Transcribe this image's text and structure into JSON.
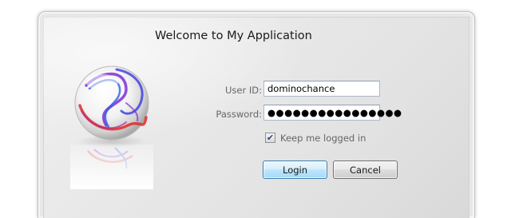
{
  "dialog": {
    "title": "Welcome to My Application"
  },
  "logo": {
    "icon": "swirl-orb-logo",
    "colors": [
      "#7b2fd6",
      "#2f5ee0",
      "#e02a2a"
    ]
  },
  "form": {
    "user_id_label": "User ID:",
    "user_id_value": "dominochance",
    "password_label": "Password:",
    "password_value": "●●●●●●●●●●●●●●●●",
    "keep_logged_in_label": "Keep me logged in",
    "keep_logged_in_checked": true,
    "checkmark": "✔"
  },
  "buttons": {
    "login_label": "Login",
    "cancel_label": "Cancel"
  }
}
